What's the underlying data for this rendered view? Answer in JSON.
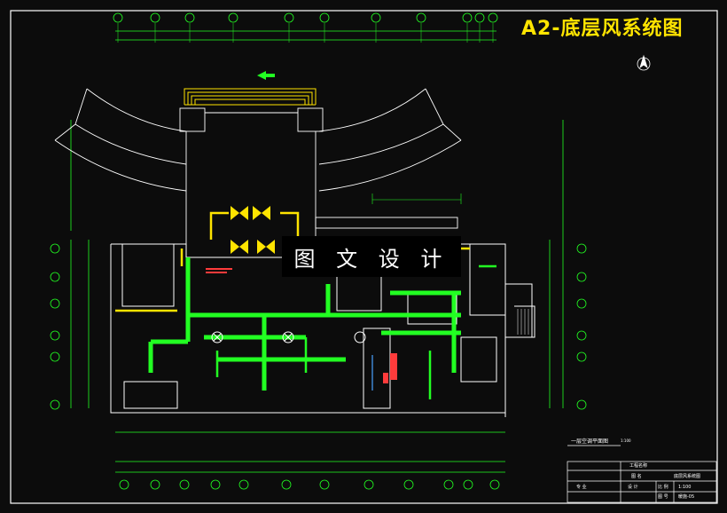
{
  "title": "A2-底层风系统图",
  "watermark": "图 文 设 计",
  "plan_caption": "一层空调平面图",
  "plan_scale": "1:100",
  "title_block": {
    "project_label": "工程名称",
    "drawing_label": "图 名",
    "drawing_name": "底层风系统图",
    "design_label": "设 计",
    "scale_label": "比 例",
    "scale_value": "1:100",
    "sheet_label": "图 号",
    "sheet_value": "暖施-05",
    "profession_label": "专 业"
  },
  "colors": {
    "background": "#0c0c0c",
    "wall": "#ffffff",
    "duct": "#22ff22",
    "supply": "#ffe400",
    "dimension": "#22ff22",
    "annotation": "#ff3b3b",
    "pipe": "#4aa3ff"
  },
  "axis_labels_top": [
    "①",
    "②",
    "③",
    "④",
    "⑤",
    "⑥",
    "⑦",
    "⑧",
    "⑨",
    "⑩",
    "⑪"
  ],
  "axis_labels_side": [
    "Ⓐ",
    "Ⓑ",
    "Ⓒ",
    "Ⓓ",
    "Ⓔ",
    "Ⓕ"
  ],
  "icons": [
    "north-arrow-icon"
  ]
}
